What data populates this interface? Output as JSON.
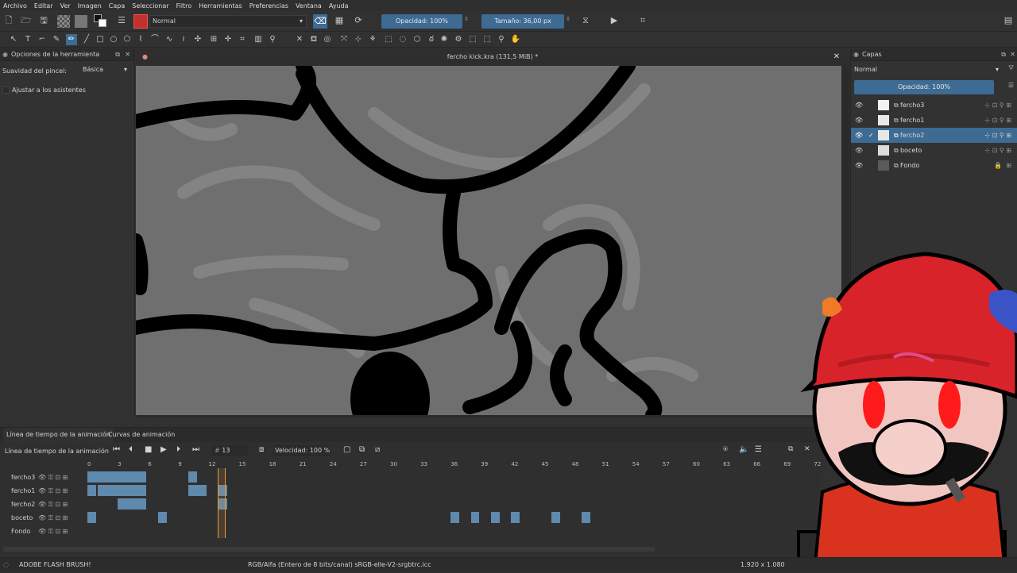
{
  "menubar": {
    "items": [
      "Archivo",
      "Editar",
      "Ver",
      "Imagen",
      "Capa",
      "Seleccionar",
      "Filtro",
      "Herramientas",
      "Preferencias",
      "Ventana",
      "Ayuda"
    ]
  },
  "toolbar": {
    "blend_mode": "Normal",
    "opacity_label": "Opacidad: 100%",
    "size_label": "Tamaño: 36,00 px"
  },
  "tool_options": {
    "title": "Opciones de la herramienta",
    "smoothing_label": "Suavidad del pincel:",
    "smoothing_value": "Básica",
    "assistants_label": "Ajustar a los asistentes"
  },
  "document": {
    "title": "fercho kick.kra (131,5 MiB) *"
  },
  "layers": {
    "title": "Capas",
    "blend_mode": "Normal",
    "opacity_label": "Opacidad:  100%",
    "items": [
      {
        "name": "fercho3",
        "selected": false
      },
      {
        "name": "fercho1",
        "selected": false
      },
      {
        "name": "fercho2",
        "selected": true
      },
      {
        "name": "boceto",
        "selected": false
      },
      {
        "name": "Fondo",
        "selected": false
      }
    ]
  },
  "timeline": {
    "tab1": "Línea de tiempo de la animación",
    "tab2": "Curvas de animación",
    "header_label": "Línea de tiempo de la animación",
    "current_frame": "13",
    "speed_label": "Velocidad: 100 %",
    "ruler": [
      "0",
      "3",
      "6",
      "9",
      "12",
      "15",
      "18",
      "21",
      "24",
      "27",
      "30",
      "33",
      "36",
      "39",
      "42",
      "45",
      "48",
      "51",
      "54",
      "57",
      "60",
      "63",
      "66",
      "69",
      "72"
    ],
    "rows": [
      "fercho3",
      "fercho1",
      "fercho2",
      "boceto",
      "Fondo"
    ]
  },
  "status": {
    "brush": "ADOBE FLASH BRUSH!",
    "color_space": "RGB/Alfa (Entero de 8 bits/canal)  sRGB-elle-V2-srgbtrc.icc",
    "dimensions": "1.920 x 1.080"
  },
  "colors": {
    "accent": "#3d6b94",
    "frame": "#5f89ad",
    "current_frame": "#e59a3a"
  }
}
